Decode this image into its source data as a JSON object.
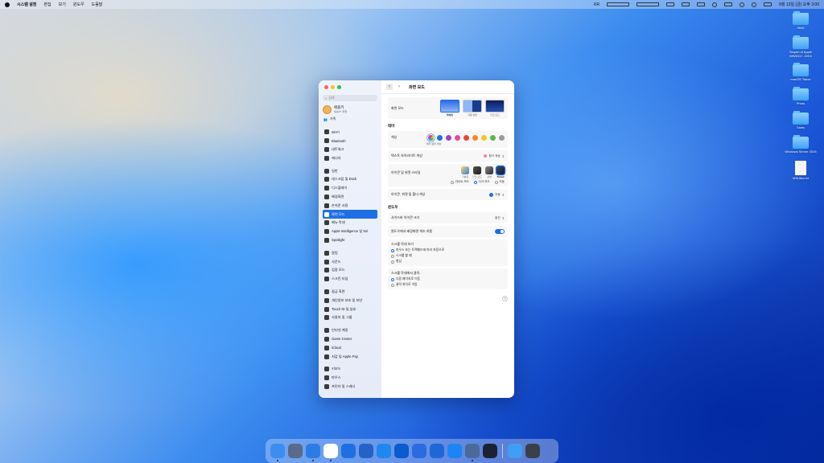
{
  "menubar": {
    "app": "시스템 설정",
    "items": [
      "편집",
      "보기",
      "윈도우",
      "도움말"
    ],
    "right_label": "KR",
    "clock": "9월 13일 (금) 오후 3:00"
  },
  "desktop": {
    "items": [
      {
        "label": "9845",
        "type": "folder"
      },
      {
        "label": "Sequin of Apple WWDC2...0904",
        "type": "folder"
      },
      {
        "label": "macOS Tahoe",
        "type": "folder"
      },
      {
        "label": "Photo",
        "type": "folder"
      },
      {
        "label": "Sales",
        "type": "folder"
      },
      {
        "label": "Windows Server 2025",
        "type": "folder"
      },
      {
        "label": "MSUltra.txt",
        "type": "document"
      }
    ]
  },
  "window": {
    "title": "화면 모드",
    "sidebar": {
      "search_placeholder": "검색",
      "account": {
        "name": "애플키",
        "sub": "Apple 계정"
      },
      "family": "가족",
      "groups": [
        [
          {
            "label": "Wi-Fi",
            "icon": "wifi-icon"
          },
          {
            "label": "Bluetooth",
            "icon": "bluetooth-icon"
          },
          {
            "label": "네트워크",
            "icon": "network-icon"
          },
          {
            "label": "에너지",
            "icon": "energy-icon"
          }
        ],
        [
          {
            "label": "일반",
            "icon": "gear-icon"
          },
          {
            "label": "데스크탑 및 Dock",
            "icon": "dock-icon"
          },
          {
            "label": "디스플레이",
            "icon": "display-icon"
          },
          {
            "label": "배경화면",
            "icon": "wallpaper-icon"
          },
          {
            "label": "손쉬운 사용",
            "icon": "accessibility-icon"
          },
          {
            "label": "화면 모드",
            "icon": "appearance-icon",
            "selected": true
          },
          {
            "label": "메뉴 막대",
            "icon": "menubar-icon"
          },
          {
            "label": "Apple Intelligence 및 Siri",
            "icon": "siri-icon"
          },
          {
            "label": "Spotlight",
            "icon": "spotlight-icon"
          }
        ],
        [
          {
            "label": "알림",
            "icon": "notifications-icon"
          },
          {
            "label": "사운드",
            "icon": "sound-icon"
          },
          {
            "label": "집중 모드",
            "icon": "focus-icon"
          },
          {
            "label": "스크린 타임",
            "icon": "screentime-icon"
          }
        ],
        [
          {
            "label": "잠금 화면",
            "icon": "lock-screen-icon"
          },
          {
            "label": "개인정보 보호 및 보안",
            "icon": "privacy-icon"
          },
          {
            "label": "Touch ID 및 암호",
            "icon": "touchid-icon"
          },
          {
            "label": "사용자 및 그룹",
            "icon": "users-icon"
          }
        ],
        [
          {
            "label": "인터넷 계정",
            "icon": "internet-accounts-icon"
          },
          {
            "label": "Game Center",
            "icon": "gamecenter-icon"
          },
          {
            "label": "iCloud",
            "icon": "icloud-icon"
          },
          {
            "label": "지갑 및 Apple Pay",
            "icon": "wallet-icon"
          }
        ],
        [
          {
            "label": "키보드",
            "icon": "keyboard-icon"
          },
          {
            "label": "마우스",
            "icon": "mouse-icon"
          },
          {
            "label": "프린터 및 스캐너",
            "icon": "printer-icon"
          }
        ]
      ]
    },
    "content": {
      "appearance_label": "화면 모드",
      "appearance_options": [
        {
          "label": "라이트",
          "selected": true
        },
        {
          "label": "자동 변환",
          "selected": false
        },
        {
          "label": "다크 모드",
          "selected": false
        }
      ],
      "theme_heading": "테마",
      "accent_label": "색상",
      "accent_caption": "멀티 컬러 색상",
      "accent_colors": [
        "multicolor",
        "#1e6fe6",
        "#9b43c2",
        "#e8479b",
        "#e8453c",
        "#f38b1f",
        "#f6c324",
        "#5ab84a",
        "#9a9a9a"
      ],
      "highlight_label": "텍스트 하이라이트 색상",
      "highlight_value": "핑크 색상",
      "icon_style_label": "아이콘 및 위젯 스타일",
      "icon_styles": [
        {
          "label": "기본값",
          "selected": false
        },
        {
          "label": "다크 모드",
          "selected": false
        },
        {
          "label": "선명",
          "selected": false
        },
        {
          "label": "Tinted",
          "selected": true
        }
      ],
      "icon_mode_radios": [
        {
          "label": "라이트 모드",
          "selected": false
        },
        {
          "label": "다크 모드",
          "selected": true
        },
        {
          "label": "자동",
          "selected": false
        }
      ],
      "folder_color_label": "아이콘, 위젯 및 폴더 색상",
      "folder_color_value": "자동",
      "window_heading": "윈도우",
      "sidebar_icon_label": "사이드바 아이콘 크기",
      "sidebar_icon_value": "중간",
      "tint_label": "윈도우에서 배경화면 색조 허용",
      "tint_on": true,
      "scroll_label": "스크롤 막대 보기",
      "scroll_options": [
        {
          "label": "마우스 또는 트랙패드에 따라 자동으로",
          "selected": true
        },
        {
          "label": "스크롤 할 때",
          "selected": false
        },
        {
          "label": "항상",
          "selected": false
        }
      ],
      "click_label": "스크롤 막대에서 클릭:",
      "click_options": [
        {
          "label": "다음 페이지로 이동",
          "selected": true
        },
        {
          "label": "클릭 위치로 이동",
          "selected": false
        }
      ],
      "help": "?"
    }
  },
  "dock": {
    "apps": [
      {
        "icon": "finder-icon",
        "color": "#3b8ef0",
        "running": true
      },
      {
        "icon": "launchpad-icon",
        "color": "#5a6a8a",
        "running": false
      },
      {
        "icon": "safari-icon",
        "color": "#2d7be5",
        "running": true
      },
      {
        "icon": "chrome-icon",
        "color": "#ffffff",
        "running": true
      },
      {
        "icon": "app-icon",
        "color": "#1f6fe0",
        "running": false
      },
      {
        "icon": "app-icon",
        "color": "#2562c8",
        "running": false
      },
      {
        "icon": "folder-app-icon",
        "color": "#1e88f0",
        "running": false
      },
      {
        "icon": "app-icon",
        "color": "#0b5bd0",
        "running": false
      },
      {
        "icon": "app-icon",
        "color": "#2a6be0",
        "running": false
      },
      {
        "icon": "app-icon",
        "color": "#1f67d8",
        "running": false
      },
      {
        "icon": "appstore-icon",
        "color": "#1c84f5",
        "running": false
      },
      {
        "icon": "settings-icon",
        "color": "#4a6a9a",
        "running": true
      },
      {
        "icon": "terminal-icon",
        "color": "#1c2233",
        "running": false
      }
    ],
    "extras": [
      {
        "icon": "downloads-folder-icon",
        "color": "#3da0f5"
      },
      {
        "icon": "trash-icon",
        "color": "#3a3f4a"
      }
    ]
  }
}
